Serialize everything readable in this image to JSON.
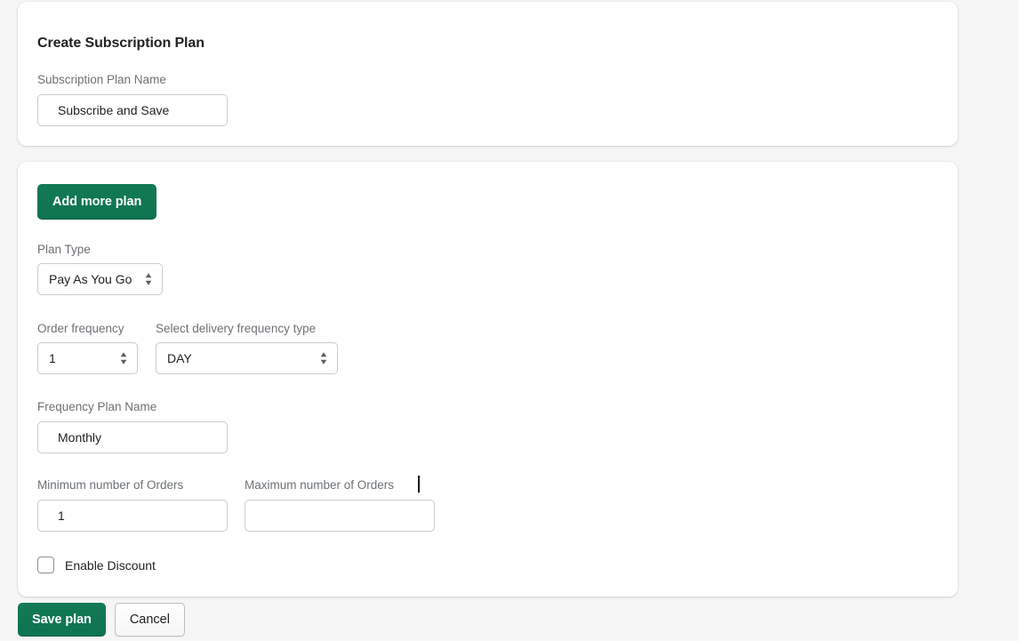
{
  "header_card": {
    "title": "Create Subscription Plan",
    "plan_name_label": "Subscription Plan Name",
    "plan_name_value": "Subscribe and Save",
    "plan_name_placeholder": ""
  },
  "body_card": {
    "add_more_plan_label": "Add more plan",
    "plan_type_label": "Plan Type",
    "plan_type_value": "Pay As You Go",
    "order_frequency_label": "Order frequency",
    "order_frequency_value": "1",
    "delivery_frequency_label": "Select delivery frequency type",
    "delivery_frequency_value": "DAY",
    "frequency_plan_name_label": "Frequency Plan Name",
    "frequency_plan_name_value": "Monthly",
    "min_orders_label": "Minimum number of Orders",
    "min_orders_value": "1",
    "max_orders_label": "Maximum number of Orders",
    "max_orders_value": "",
    "max_orders_placeholder": "",
    "enable_discount_label": "Enable Discount",
    "enable_discount_checked": false
  },
  "footer": {
    "save_label": "Save plan",
    "cancel_label": "Cancel"
  },
  "colors": {
    "page_background": "#f6f6f7",
    "card_background": "#ffffff",
    "primary_button": "#127a55",
    "label_text": "#6d7175",
    "body_text": "#202223",
    "input_border": "#c9cccf",
    "caret": "#111213"
  },
  "icons": {
    "select_chevrons": "chevron-up-down-icon",
    "checkbox": "checkbox-unchecked-icon"
  }
}
